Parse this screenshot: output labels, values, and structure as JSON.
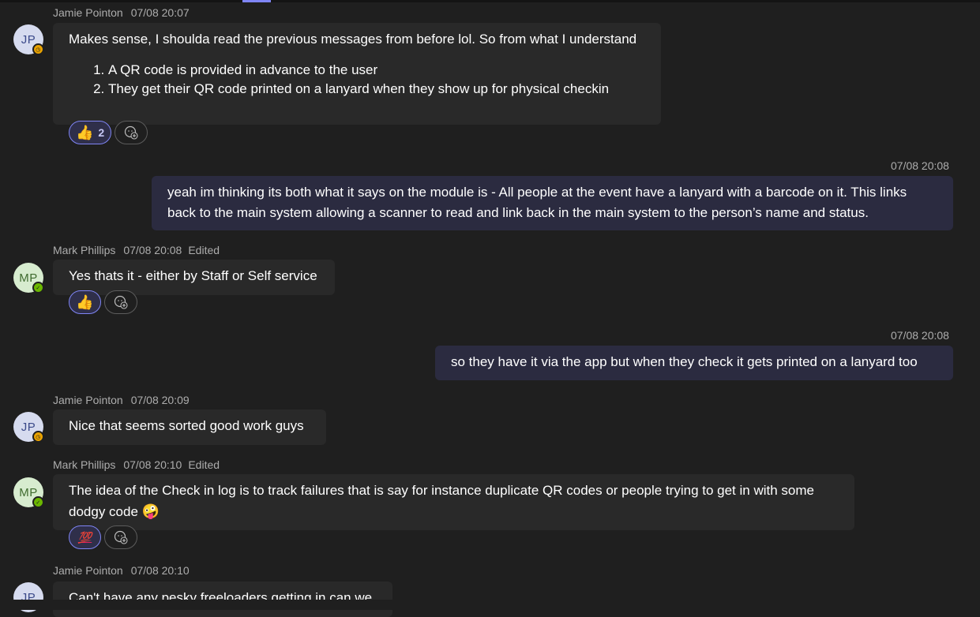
{
  "messages": [
    {
      "author": "Jamie Pointon",
      "timestamp": "07/08 20:07",
      "initials": "JP",
      "text": "Makes sense, I shoulda read the previous messages from before lol. So from what I understand",
      "list": [
        "A QR code is provided in advance to the user",
        "They get their QR code printed on a lanyard when they show up for physical checkin"
      ],
      "reaction": {
        "emoji": "👍",
        "icon": "thumbs-up-icon",
        "count": "2"
      }
    },
    {
      "self": true,
      "timestamp": "07/08 20:08",
      "text": "yeah im thinking its both what it says on the module is - All people at the event have a lanyard with a barcode on it. This links back to the main system allowing a scanner to read and link back in the main system to the person’s name and status."
    },
    {
      "author": "Mark Phillips",
      "timestamp": "07/08 20:08",
      "edited": "Edited",
      "initials": "MP",
      "text": "Yes thats it - either by Staff or Self service",
      "reaction": {
        "emoji": "👍",
        "icon": "thumbs-up-icon"
      }
    },
    {
      "self": true,
      "timestamp": "07/08 20:08",
      "text": "so they have it via the app but when they check it gets printed on a lanyard too"
    },
    {
      "author": "Jamie Pointon",
      "timestamp": "07/08 20:09",
      "initials": "JP",
      "text": "Nice that seems sorted good work guys"
    },
    {
      "author": "Mark Phillips",
      "timestamp": "07/08 20:10",
      "edited": "Edited",
      "initials": "MP",
      "text": "The idea of the Check in log  is to track failures that is say for instance duplicate QR codes or people trying to get in with some dodgy code",
      "emoji": "🤪",
      "reaction": {
        "emoji": "💯",
        "icon": "hundred-points-icon"
      }
    },
    {
      "author": "Jamie Pointon",
      "timestamp": "07/08 20:10",
      "initials": "JP",
      "text": "Can't have any pesky freeloaders getting in can we"
    }
  ],
  "colors": {
    "background": "#1f1f1f",
    "bubble_other": "#292929",
    "bubble_self": "#2b2b40",
    "accent": "#7f85f5",
    "status_away": "#eaa300",
    "status_available": "#6bb700"
  }
}
